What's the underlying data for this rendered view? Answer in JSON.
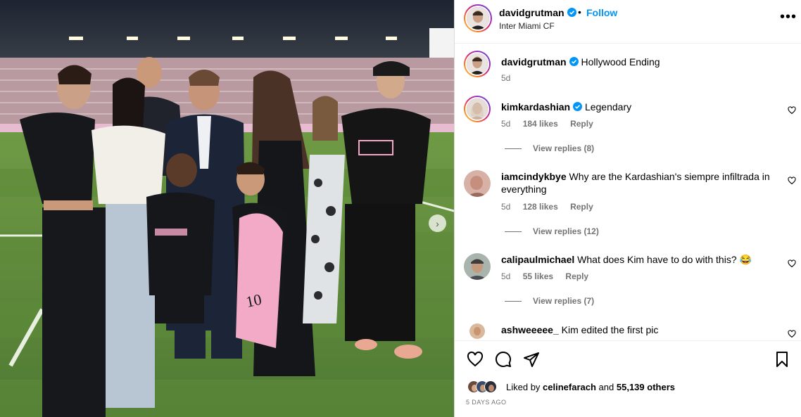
{
  "post": {
    "username": "davidgrutman",
    "follow_label": "Follow",
    "separator": "•",
    "location": "Inter Miami CF",
    "more_label": "•••",
    "photo_next_label": "›"
  },
  "caption": {
    "username": "davidgrutman",
    "text": "Hollywood Ending",
    "time": "5d"
  },
  "comments": [
    {
      "username": "kimkardashian",
      "verified": true,
      "text": "Legendary",
      "time": "5d",
      "likes": "184 likes",
      "reply": "Reply",
      "view_replies": "View replies (8)"
    },
    {
      "username": "iamcindykbye",
      "verified": false,
      "text": "Why are the Kardashian's siempre infiltrada in everything",
      "time": "5d",
      "likes": "128 likes",
      "reply": "Reply",
      "view_replies": "View replies (12)"
    },
    {
      "username": "calipaulmichael",
      "verified": false,
      "text": "What does Kim have to do with this? 😂",
      "time": "5d",
      "likes": "55 likes",
      "reply": "Reply",
      "view_replies": "View replies (7)"
    },
    {
      "username": "ashweeeee_",
      "verified": false,
      "text": "Kim edited the first pic",
      "time": "",
      "likes": "",
      "reply": "",
      "view_replies": ""
    }
  ],
  "likes": {
    "prefix": "Liked by",
    "user": "celinefarach",
    "connector": "and",
    "others": "55,139 others"
  },
  "date": "5 DAYS AGO",
  "colors": {
    "accent": "#0095f6",
    "verified": "#0095f6",
    "muted": "#737373"
  },
  "icons": [
    "heart-icon",
    "comment-icon",
    "share-icon",
    "bookmark-icon",
    "more-icon",
    "verified-icon",
    "chevron-right-icon"
  ]
}
